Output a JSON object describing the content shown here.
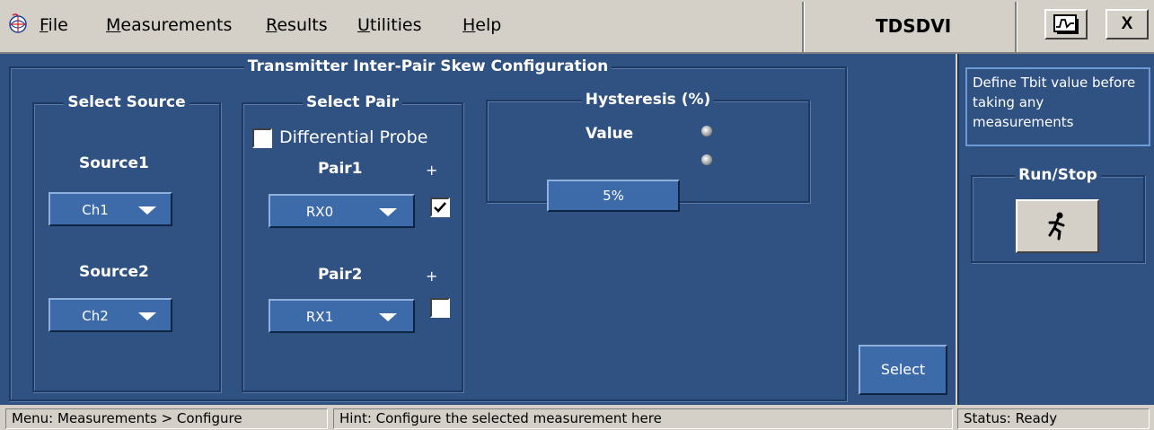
{
  "menubar": {
    "items": [
      {
        "prefix": "",
        "ul": "F",
        "rest": "ile"
      },
      {
        "prefix": "",
        "ul": "M",
        "rest": "easurements"
      },
      {
        "prefix": "",
        "ul": "R",
        "rest": "esults"
      },
      {
        "prefix": "",
        "ul": "U",
        "rest": "tilities"
      },
      {
        "prefix": "",
        "ul": "H",
        "rest": "elp"
      }
    ],
    "app_title": "TDSDVI",
    "close_label": "X"
  },
  "config": {
    "title": "Transmitter Inter-Pair Skew Configuration",
    "select_source": {
      "title": "Select Source",
      "source1_label": "Source1",
      "source1_value": "Ch1",
      "source2_label": "Source2",
      "source2_value": "Ch2"
    },
    "select_pair": {
      "title": "Select Pair",
      "differential_probe_label": "Differential Probe",
      "differential_probe_checked": false,
      "pair1_label": "Pair1",
      "pair1_value": "RX0",
      "pair1_plus": "+",
      "pair1_checked": true,
      "pair2_label": "Pair2",
      "pair2_value": "RX1",
      "pair2_plus": "+",
      "pair2_checked": false
    },
    "hysteresis": {
      "title": "Hysteresis (%)",
      "value_label": "Value",
      "value": "5%"
    },
    "select_button": "Select"
  },
  "side_panel": {
    "hint": "Define Tbit value before taking any measurements",
    "runstop_title": "Run/Stop"
  },
  "statusbar": {
    "menu": "Menu: Measurements > Configure",
    "hint": "Hint: Configure the selected measurement here",
    "status": "Status: Ready"
  },
  "colors": {
    "panel_bg": "#2f5283",
    "control_bg": "#3d6aa8",
    "chrome_bg": "#d4d0c8"
  }
}
